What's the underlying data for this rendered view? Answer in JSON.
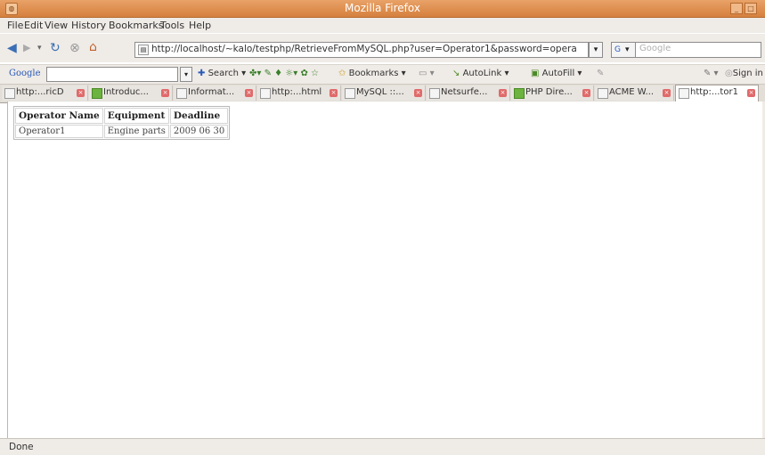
{
  "window": {
    "title": "Mozilla Firefox",
    "app_icon": "firefox-icon"
  },
  "menu": [
    {
      "key": "F",
      "rest": "ile"
    },
    {
      "key": "E",
      "rest": "dit"
    },
    {
      "key": "V",
      "rest": "iew"
    },
    {
      "key": "",
      "rest": "History",
      "u": "s"
    },
    {
      "key": "B",
      "rest": "ookmarks"
    },
    {
      "key": "T",
      "rest": "ools"
    },
    {
      "key": "H",
      "rest": "elp"
    }
  ],
  "menu_labels": [
    "File",
    "Edit",
    "View",
    "History",
    "Bookmarks",
    "Tools",
    "Help"
  ],
  "navigation": {
    "url": "http://localhost/~kalo/testphp/RetrieveFromMySQL.php?user=Operator1&password=opera",
    "search_placeholder": "Google"
  },
  "google_toolbar": {
    "logo": "Google",
    "search_label": "Search",
    "bookmarks_label": "Bookmarks",
    "autolink_label": "AutoLink",
    "autofill_label": "AutoFill",
    "signin_label": "Sign in"
  },
  "tabs": [
    {
      "label": "http:...ricD",
      "icon": "page-icon"
    },
    {
      "label": "Introduc...",
      "icon": "green-page-icon"
    },
    {
      "label": "Informat...",
      "icon": "page-icon"
    },
    {
      "label": "http:...html",
      "icon": "page-icon"
    },
    {
      "label": "MySQL ::...",
      "icon": "page-icon"
    },
    {
      "label": "Netsurfe...",
      "icon": "page-icon"
    },
    {
      "label": "PHP Dire...",
      "icon": "green-page-icon"
    },
    {
      "label": "ACME W...",
      "icon": "page-icon"
    },
    {
      "label": "http:...tor1",
      "icon": "page-icon",
      "active": true
    }
  ],
  "table": {
    "headers": [
      "Operator Name",
      "Equipment",
      "Deadline"
    ],
    "rows": [
      [
        "Operator1",
        "Engine parts",
        "2009 06 30"
      ]
    ]
  },
  "status": "Done",
  "colors": {
    "titlebar": "#d6803e",
    "chrome": "#efebe7"
  }
}
